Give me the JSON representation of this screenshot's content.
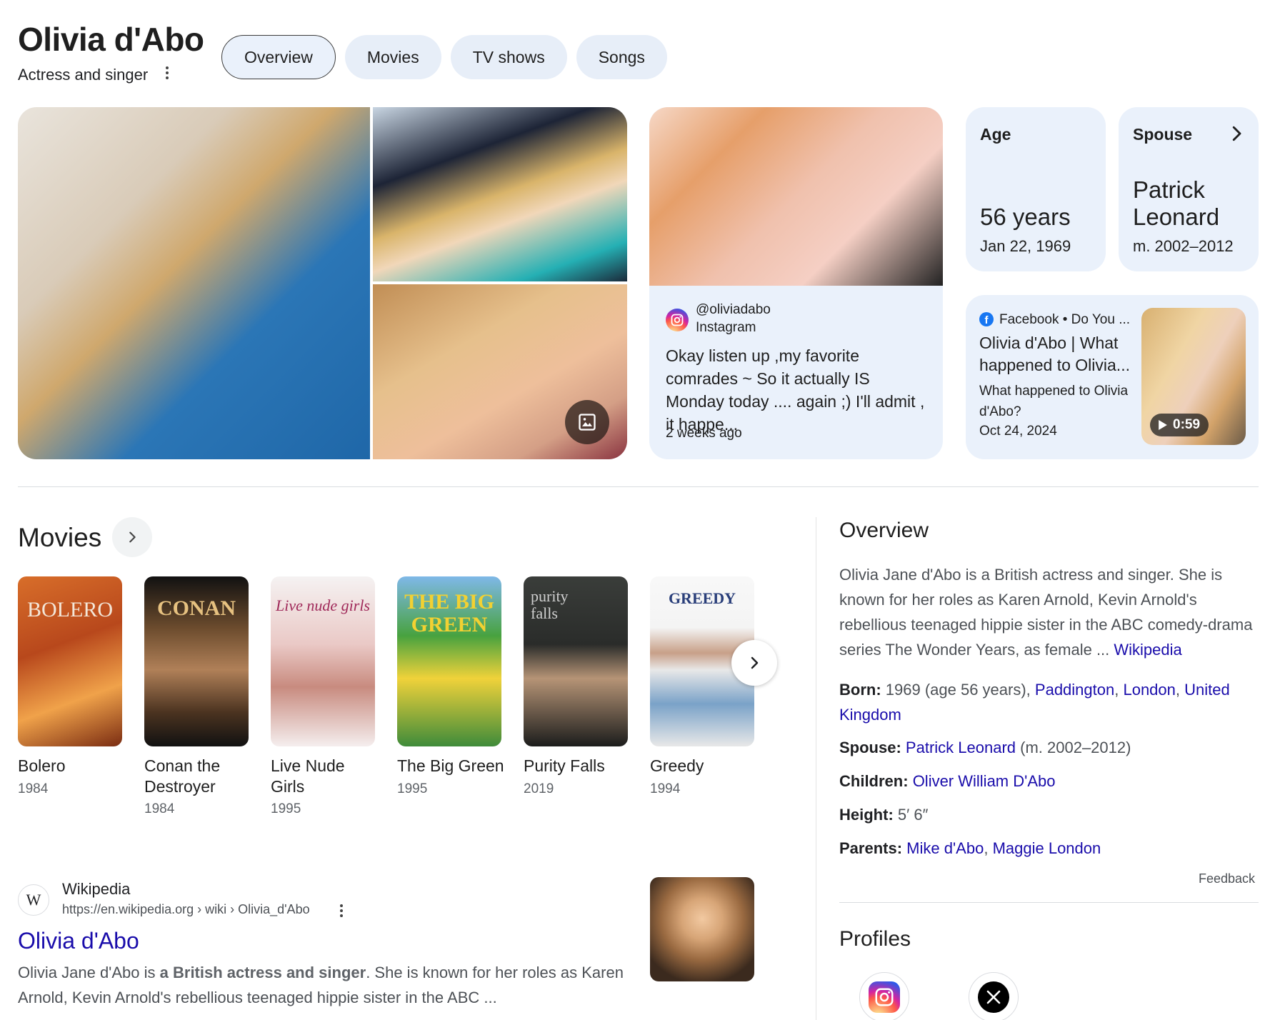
{
  "header": {
    "title": "Olivia d'Abo",
    "subtitle": "Actress and singer",
    "tabs": [
      {
        "label": "Overview",
        "active": true
      },
      {
        "label": "Movies",
        "active": false
      },
      {
        "label": "TV shows",
        "active": false
      },
      {
        "label": "Songs",
        "active": false
      }
    ]
  },
  "instagram": {
    "handle": "@oliviadabo",
    "source": "Instagram",
    "post": "Okay listen up ,my favorite comrades ~ So it actually IS Monday today .... again ;) I'll admit , it happe...",
    "time": "2 weeks ago"
  },
  "age": {
    "label": "Age",
    "value": "56 years",
    "detail": "Jan 22, 1969"
  },
  "spouse": {
    "label": "Spouse",
    "value_line1": "Patrick",
    "value_line2": "Leonard",
    "detail": "m. 2002–2012"
  },
  "facebook": {
    "source": "Facebook • Do You ...",
    "title": "Olivia d'Abo | What happened to Olivia...",
    "desc": "What happened to Olivia d'Abo?",
    "date": "Oct 24, 2024",
    "duration": "0:59"
  },
  "movies": {
    "title": "Movies",
    "items": [
      {
        "name": "Bolero",
        "year": "1984",
        "poster": "BOLERO"
      },
      {
        "name": "Conan the Destroyer",
        "year": "1984",
        "poster": "CONAN"
      },
      {
        "name": "Live Nude Girls",
        "year": "1995",
        "poster": "Live nude girls"
      },
      {
        "name": "The Big Green",
        "year": "1995",
        "poster": "THE BIG GREEN"
      },
      {
        "name": "Purity Falls",
        "year": "2019",
        "poster": "purity falls"
      },
      {
        "name": "Greedy",
        "year": "1994",
        "poster": "GREEDY"
      }
    ]
  },
  "wikipedia": {
    "site": "Wikipedia",
    "url": "https://en.wikipedia.org › wiki › Olivia_d'Abo",
    "title": "Olivia d'Abo",
    "snippet_pre": "Olivia Jane d'Abo is ",
    "snippet_bold": "a British actress and singer",
    "snippet_post": ". She is known for her roles as Karen Arnold, Kevin Arnold's rebellious teenaged hippie sister in the ABC ..."
  },
  "overview": {
    "title": "Overview",
    "text": "Olivia Jane d'Abo is a British actress and singer. She is known for her roles as Karen Arnold, Kevin Arnold's rebellious teenaged hippie sister in the ABC comedy-drama series The Wonder Years, as female ... ",
    "source_link": "Wikipedia",
    "facts": {
      "born_label": "Born:",
      "born_text": " 1969 (age 56 years), ",
      "born_links": [
        "Paddington",
        "London",
        "United Kingdom"
      ],
      "spouse_label": "Spouse:",
      "spouse_link": "Patrick Leonard",
      "spouse_text": " (m. 2002–2012)",
      "children_label": "Children:",
      "children_link": "Oliver William D'Abo",
      "height_label": "Height:",
      "height_text": " 5′ 6″",
      "parents_label": "Parents:",
      "parents_links": [
        "Mike d'Abo",
        "Maggie London"
      ]
    },
    "feedback": "Feedback",
    "profiles_title": "Profiles"
  }
}
